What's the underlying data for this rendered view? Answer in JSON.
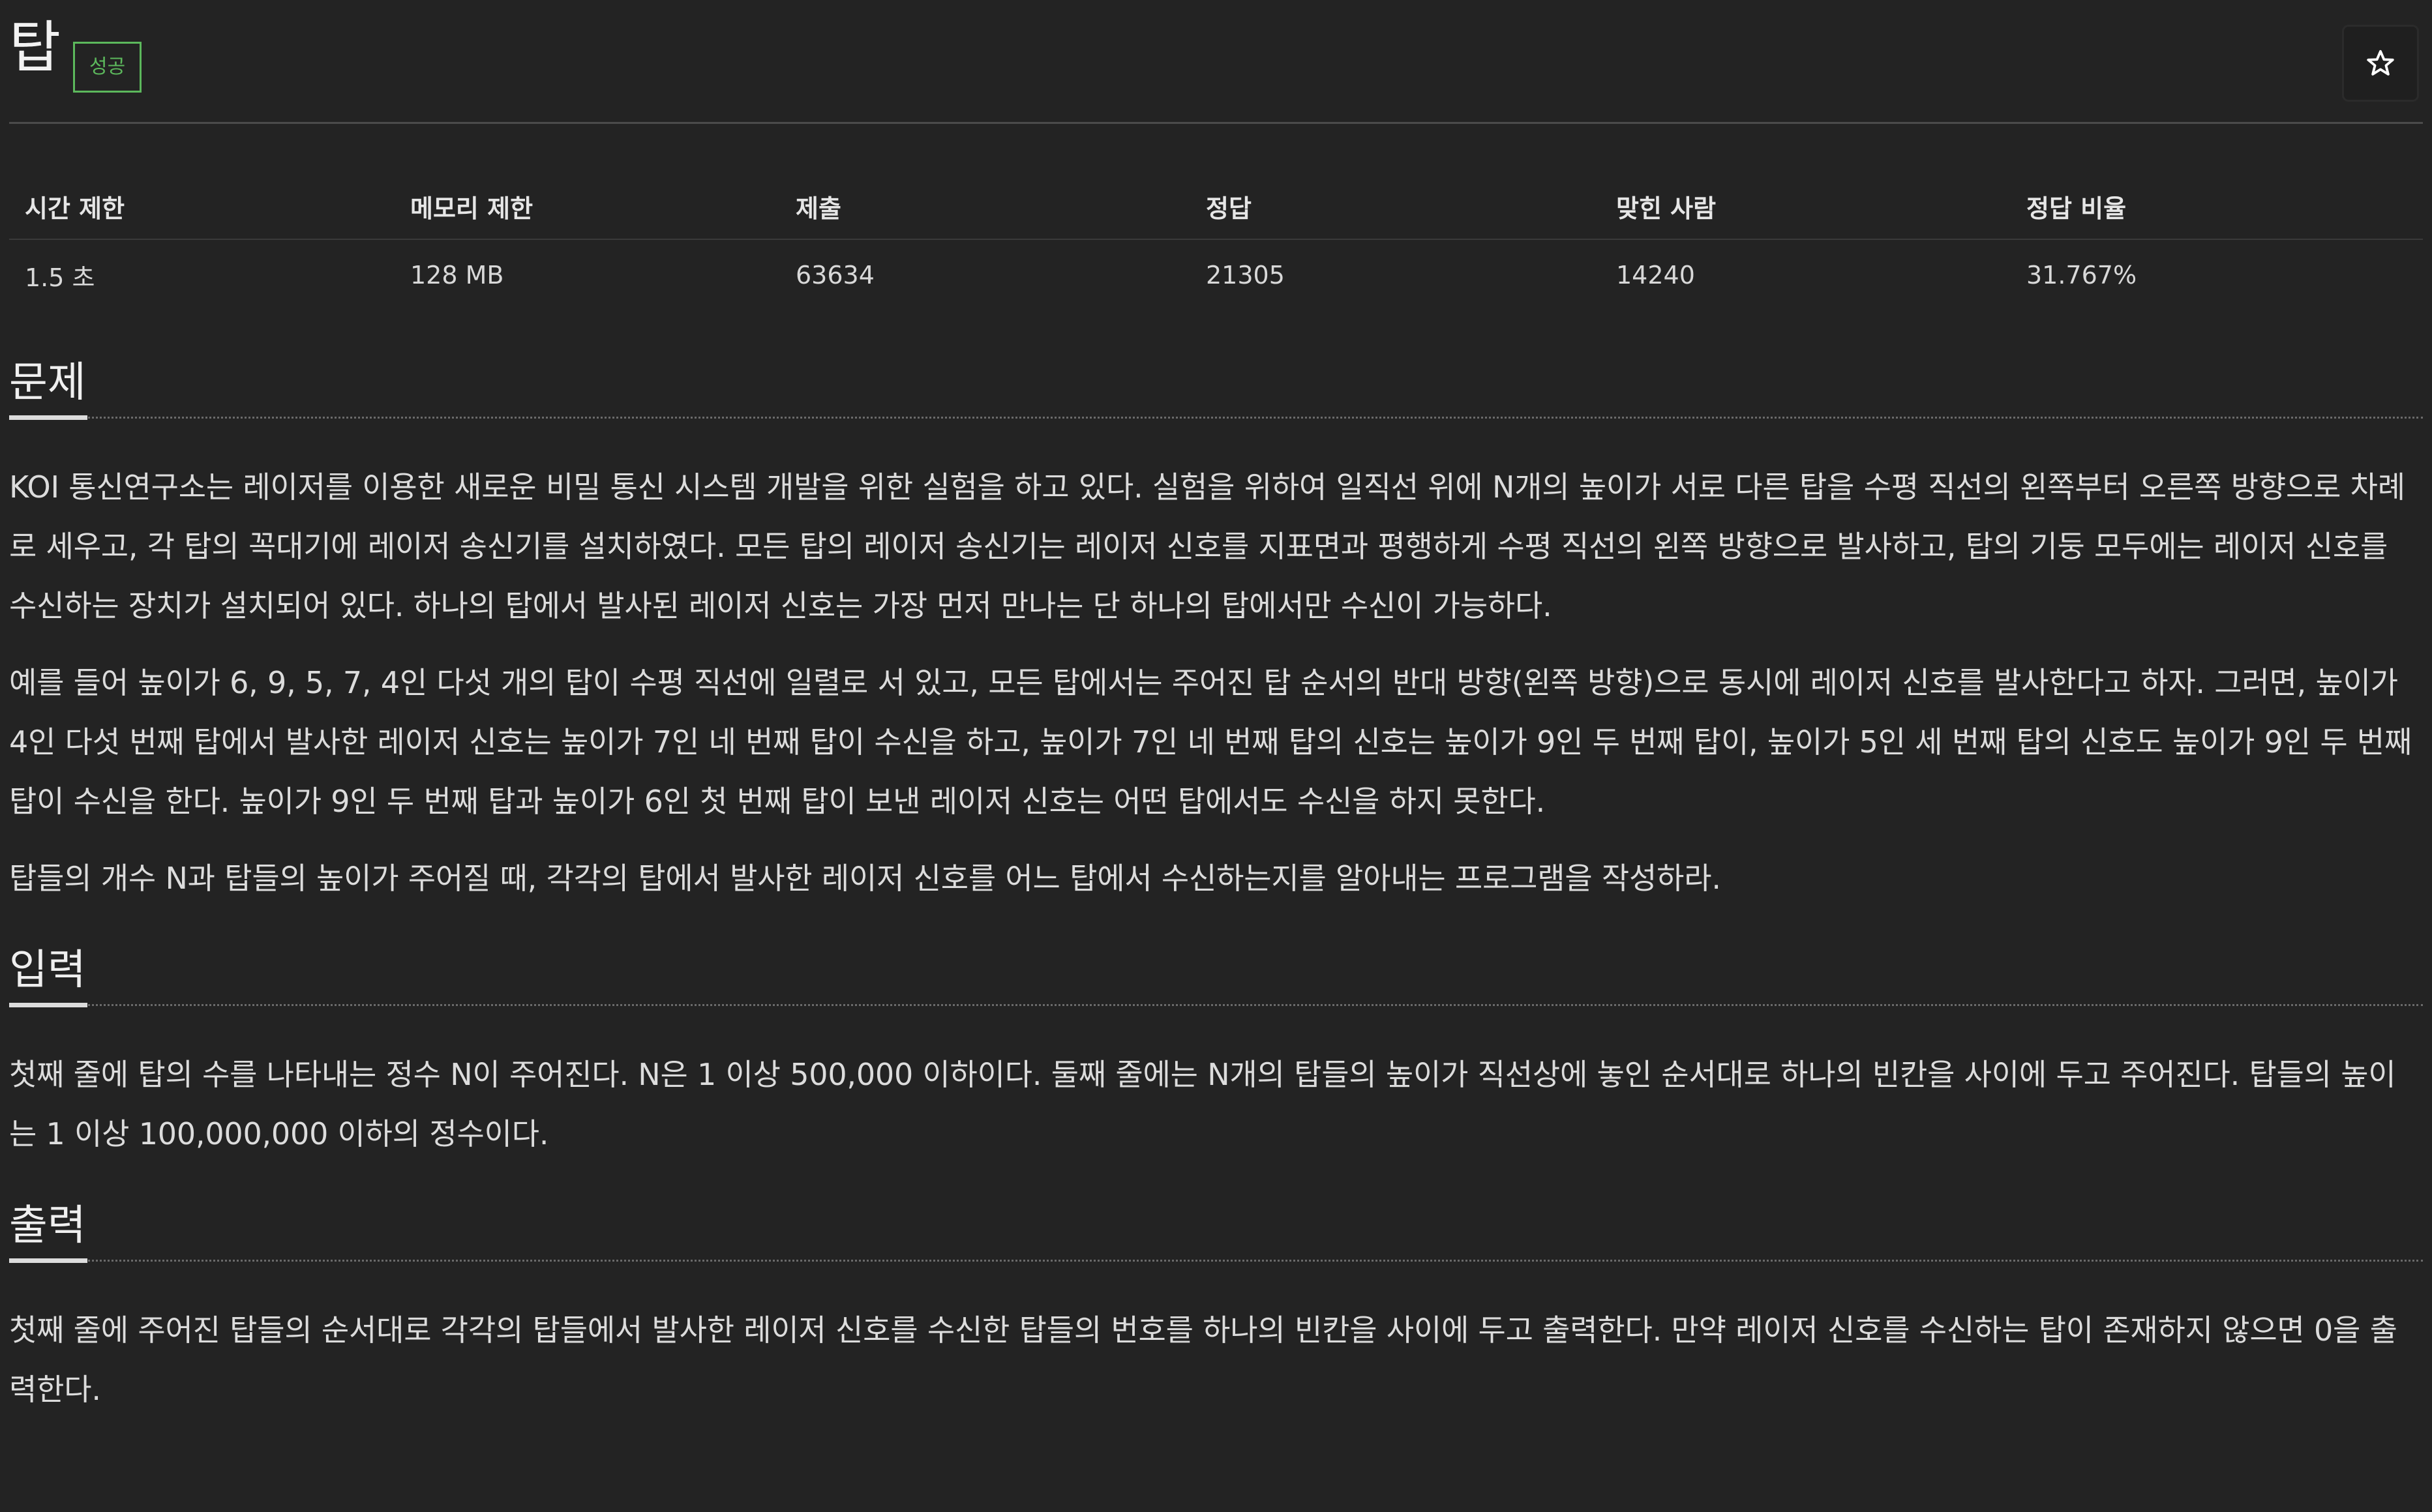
{
  "header": {
    "title": "탑",
    "status": "성공",
    "star_icon": "star-outline-icon"
  },
  "stats": {
    "headers": [
      "시간 제한",
      "메모리 제한",
      "제출",
      "정답",
      "맞힌 사람",
      "정답 비율"
    ],
    "values": [
      "1.5 초",
      "128 MB",
      "63634",
      "21305",
      "14240",
      "31.767%"
    ]
  },
  "sections": {
    "problem": {
      "heading": "문제",
      "paragraphs": [
        "KOI 통신연구소는 레이저를 이용한 새로운 비밀 통신 시스템 개발을 위한 실험을 하고 있다. 실험을 위하여 일직선 위에 N개의 높이가 서로 다른 탑을 수평 직선의 왼쪽부터 오른쪽 방향으로 차례로 세우고, 각 탑의 꼭대기에 레이저 송신기를 설치하였다. 모든 탑의 레이저 송신기는 레이저 신호를 지표면과 평행하게 수평 직선의 왼쪽 방향으로 발사하고, 탑의 기둥 모두에는 레이저 신호를 수신하는 장치가 설치되어 있다. 하나의 탑에서 발사된 레이저 신호는 가장 먼저 만나는 단 하나의 탑에서만 수신이 가능하다.",
        "예를 들어 높이가 6, 9, 5, 7, 4인 다섯 개의 탑이 수평 직선에 일렬로 서 있고, 모든 탑에서는 주어진 탑 순서의 반대 방향(왼쪽 방향)으로 동시에 레이저 신호를 발사한다고 하자. 그러면, 높이가 4인 다섯 번째 탑에서 발사한 레이저 신호는 높이가 7인 네 번째 탑이 수신을 하고, 높이가 7인 네 번째 탑의 신호는 높이가 9인 두 번째 탑이, 높이가 5인 세 번째 탑의 신호도 높이가 9인 두 번째 탑이 수신을 한다. 높이가 9인 두 번째 탑과 높이가 6인 첫 번째 탑이 보낸 레이저 신호는 어떤 탑에서도 수신을 하지 못한다.",
        "탑들의 개수 N과 탑들의 높이가 주어질 때, 각각의 탑에서 발사한 레이저 신호를 어느 탑에서 수신하는지를 알아내는 프로그램을 작성하라."
      ]
    },
    "input": {
      "heading": "입력",
      "paragraphs": [
        "첫째 줄에 탑의 수를 나타내는 정수 N이 주어진다. N은 1 이상 500,000 이하이다. 둘째 줄에는 N개의 탑들의 높이가 직선상에 놓인 순서대로 하나의 빈칸을 사이에 두고 주어진다. 탑들의 높이는 1 이상 100,000,000 이하의 정수이다."
      ]
    },
    "output": {
      "heading": "출력",
      "paragraphs": [
        "첫째 줄에 주어진 탑들의 순서대로 각각의 탑들에서 발사한 레이저 신호를 수신한 탑들의 번호를 하나의 빈칸을 사이에 두고 출력한다. 만약 레이저 신호를 수신하는 탑이 존재하지 않으면 0을 출력한다."
      ]
    }
  },
  "colors": {
    "background": "#232323",
    "text": "#dcdcdc",
    "success": "#5cb85c"
  }
}
